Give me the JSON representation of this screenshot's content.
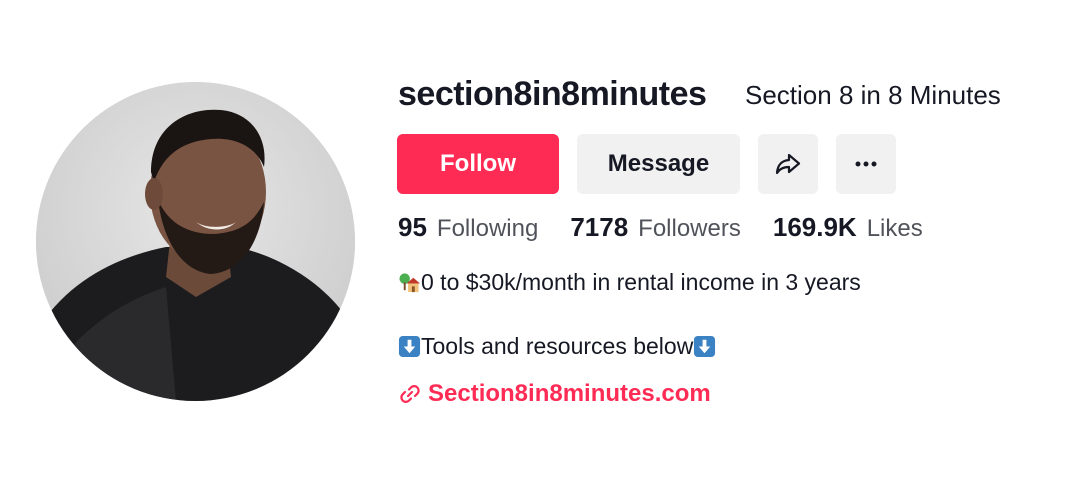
{
  "profile": {
    "username": "section8in8minutes",
    "nickname": "Section 8 in 8 Minutes",
    "avatar_icon": "profile-photo"
  },
  "actions": {
    "follow_label": "Follow",
    "message_label": "Message",
    "share_icon": "share-arrow-icon",
    "more_icon": "more-dots-icon"
  },
  "stats": {
    "following_count": "95",
    "following_label": "Following",
    "followers_count": "7178",
    "followers_label": "Followers",
    "likes_count": "169.9K",
    "likes_label": "Likes"
  },
  "bio": {
    "line1_emoji": "house-with-tree-emoji",
    "line1_text": "0 to $30k/month in rental income in 3 years",
    "line2_emoji": "down-arrow-emoji",
    "line2_text": "Tools and resources below"
  },
  "link": {
    "icon": "link-icon",
    "text": "Section8in8minutes.com"
  },
  "colors": {
    "accent": "#fe2c55",
    "button_secondary": "#f1f1f2",
    "text_primary": "#161823"
  }
}
